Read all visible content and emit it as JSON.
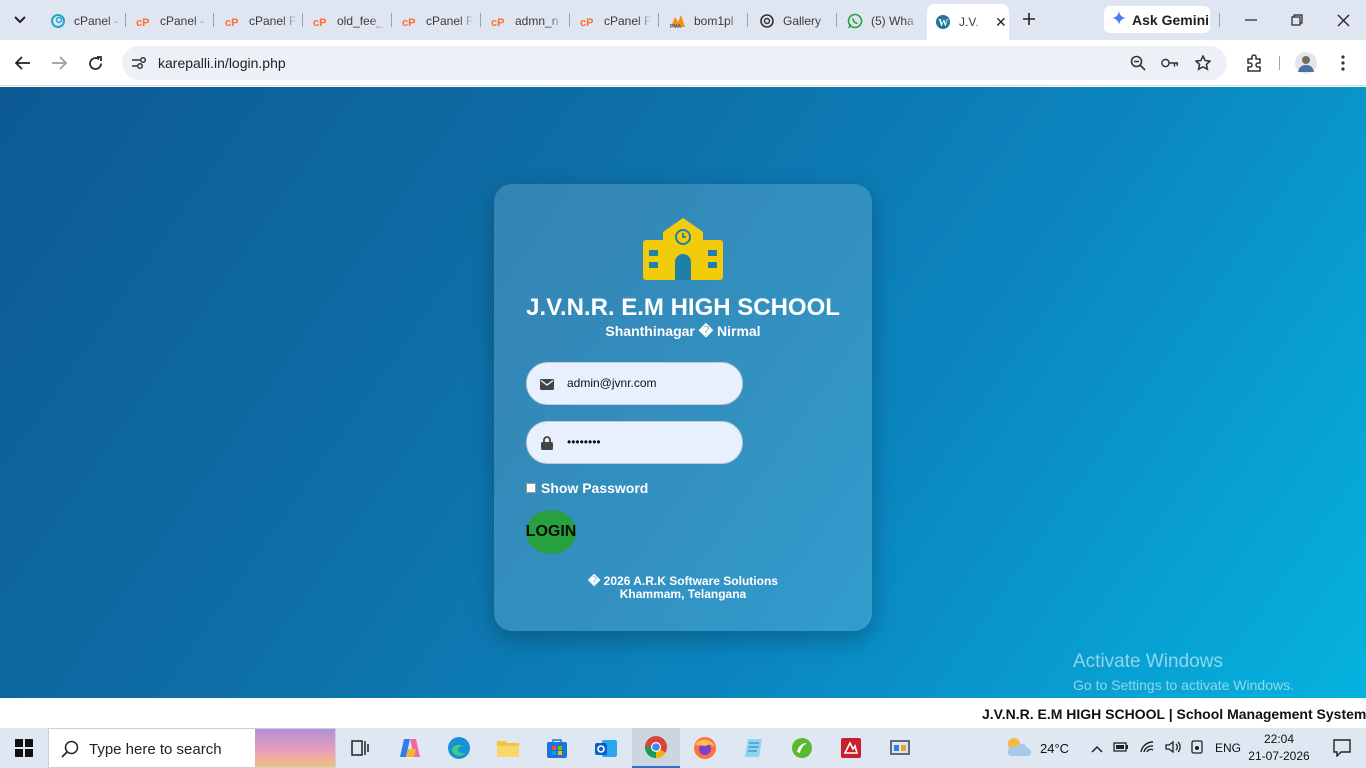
{
  "browser": {
    "tabs": [
      {
        "label": "cPanel -",
        "icon": "cpanel-swirl-icon"
      },
      {
        "label": "cPanel -",
        "icon": "cpanel-icon"
      },
      {
        "label": "cPanel F",
        "icon": "cpanel-icon"
      },
      {
        "label": "old_fee_",
        "icon": "cpanel-icon"
      },
      {
        "label": "cPanel F",
        "icon": "cpanel-icon"
      },
      {
        "label": "admn_n",
        "icon": "cpanel-icon"
      },
      {
        "label": "cPanel F",
        "icon": "cpanel-icon"
      },
      {
        "label": "bom1pl",
        "icon": "phpmyadmin-icon"
      },
      {
        "label": "Gallery",
        "icon": "openai-icon"
      },
      {
        "label": "(5) Wha",
        "icon": "whatsapp-icon"
      },
      {
        "label": "J.V.",
        "icon": "wordpress-icon",
        "active": true
      }
    ],
    "gemini_label": "Ask Gemini",
    "url": "karepalli.in/login.php"
  },
  "login": {
    "school_name": "J.V.N.R. E.M HIGH SCHOOL",
    "location": "Shanthinagar � Nirmal",
    "email_value": "admin@jvnr.com",
    "password_value": "••••••••",
    "show_password_label": "Show Password",
    "login_button": "LOGIN",
    "footer_line1": "� 2026 A.R.K Software Solutions",
    "footer_line2": "Khammam, Telangana"
  },
  "watermark": {
    "line1": "Activate Windows",
    "line2": "Go to Settings to activate Windows."
  },
  "marquee_text": "J.V.N.R. E.M HIGH SCHOOL | School Management System",
  "taskbar": {
    "search_placeholder": "Type here to search",
    "weather": "24°C",
    "language": "ENG",
    "time": "22:04",
    "date": "21-07-2026"
  },
  "colors": {
    "page_gradient_start": "#0d5a93",
    "page_gradient_end": "#05b3df",
    "login_button": "#27a03f",
    "logo": "#f2cc0a"
  }
}
